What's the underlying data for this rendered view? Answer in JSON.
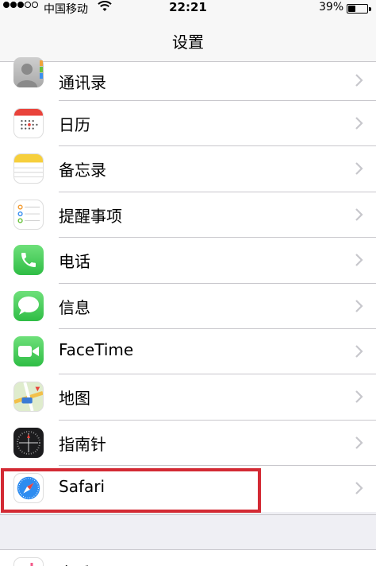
{
  "status_bar": {
    "carrier": "中国移动",
    "time": "22:21",
    "battery_percent": "39%",
    "battery_level": 0.39,
    "signal_bars_filled": 3,
    "signal_bars_total": 5
  },
  "nav": {
    "title": "设置"
  },
  "settings_items": [
    {
      "label": "通讯录",
      "icon": "contacts-icon"
    },
    {
      "label": "日历",
      "icon": "calendar-icon"
    },
    {
      "label": "备忘录",
      "icon": "notes-icon"
    },
    {
      "label": "提醒事项",
      "icon": "reminders-icon"
    },
    {
      "label": "电话",
      "icon": "phone-icon"
    },
    {
      "label": "信息",
      "icon": "messages-icon"
    },
    {
      "label": "FaceTime",
      "icon": "facetime-icon"
    },
    {
      "label": "地图",
      "icon": "maps-icon"
    },
    {
      "label": "指南针",
      "icon": "compass-icon"
    },
    {
      "label": "Safari",
      "icon": "safari-icon"
    }
  ],
  "partial_item": {
    "label": "音乐",
    "icon": "music-icon"
  },
  "colors": {
    "highlight": "#d32a34",
    "green": "#4cd964",
    "separator": "#c8c7cc"
  }
}
